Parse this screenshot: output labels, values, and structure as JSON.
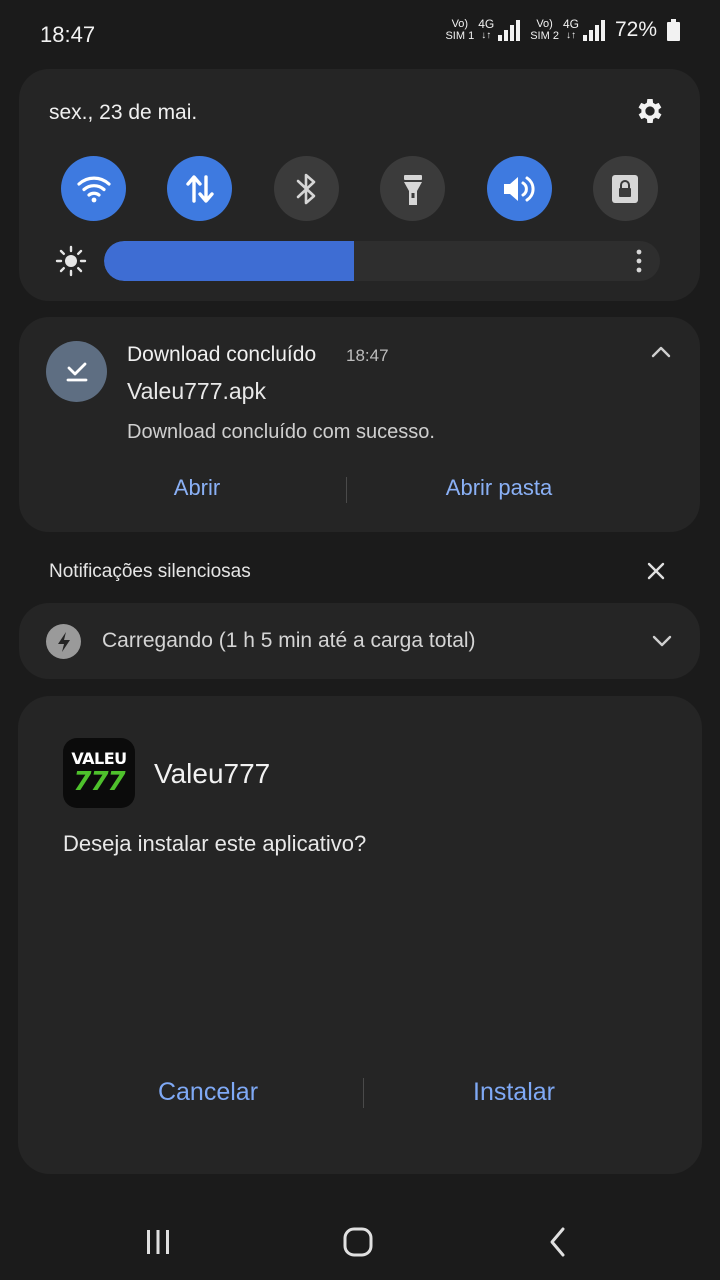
{
  "status_bar": {
    "time": "18:47",
    "sim1": {
      "volte": "Vo)",
      "label": "SIM 1",
      "network": "4G",
      "arrows": "↓↑"
    },
    "sim2": {
      "volte": "Vo)",
      "label": "SIM 2",
      "network": "4G",
      "arrows": "↓↑"
    },
    "battery_percent": "72%"
  },
  "quick_panel": {
    "date": "sex., 23 de mai.",
    "toggles": [
      {
        "icon": "wifi-icon",
        "state": "on"
      },
      {
        "icon": "mobile-data-icon",
        "state": "on"
      },
      {
        "icon": "bluetooth-icon",
        "state": "off"
      },
      {
        "icon": "flashlight-icon",
        "state": "off"
      },
      {
        "icon": "sound-icon",
        "state": "on"
      },
      {
        "icon": "screen-lock-icon",
        "state": "off"
      }
    ],
    "brightness_level": 0.45,
    "accent_color": "#3e7ae0"
  },
  "download_notification": {
    "title": "Download concluído",
    "time": "18:47",
    "filename": "Valeu777.apk",
    "description": "Download concluído com sucesso.",
    "open_label": "Abrir",
    "open_folder_label": "Abrir pasta"
  },
  "silent_notifications": {
    "header": "Notificações silenciosas",
    "charging_text": "Carregando (1 h 5 min até a carga total)"
  },
  "install_dialog": {
    "app_icon_top": "VALEU",
    "app_icon_bottom": "777",
    "app_name": "Valeu777",
    "question": "Deseja instalar este aplicativo?",
    "cancel_label": "Cancelar",
    "install_label": "Instalar",
    "button_color": "#7fa9f5"
  },
  "nav_bar": {
    "buttons": [
      "recents-icon",
      "home-icon",
      "back-icon"
    ]
  }
}
